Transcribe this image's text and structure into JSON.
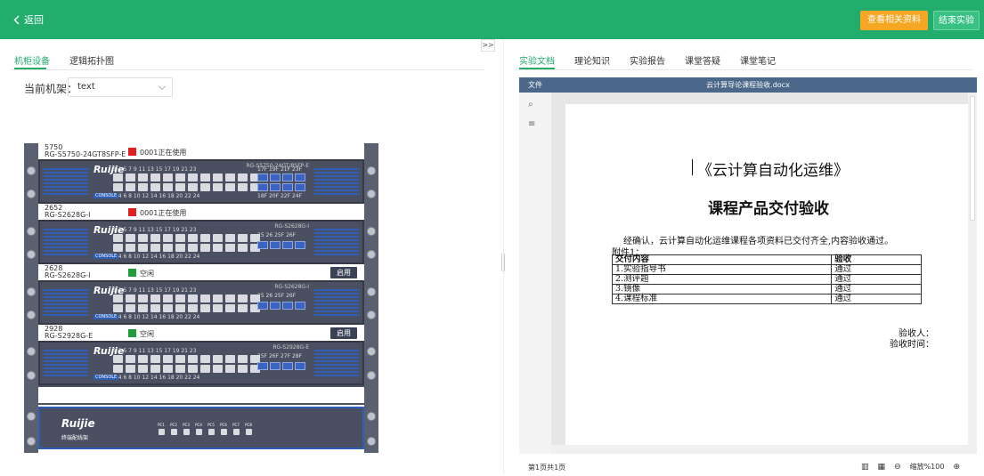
{
  "topbar": {
    "back_label": "返回",
    "materials_button": "查看相关资料",
    "end_button": "结束实验"
  },
  "left": {
    "tabs": [
      "机柜设备",
      "逻辑拓扑图"
    ],
    "rack_label": "当前机架：",
    "rack_select_value": "text",
    "collapse": ">>",
    "slots": [
      {
        "name": "5750",
        "model": "RG-S5750-24GT8SFP-E",
        "status": "0001正在使用",
        "status_color": "#e02020",
        "enable": ""
      },
      {
        "name": "2652",
        "model": "RG-S2628G-I",
        "status": "0001正在使用",
        "status_color": "#e02020",
        "enable": ""
      },
      {
        "name": "2628",
        "model": "RG-S2628G-I",
        "status": "空闲",
        "status_color": "#1f9d3b",
        "enable": "启用"
      },
      {
        "name": "2928",
        "model": "RG-S2928G-E",
        "status": "空闲",
        "status_color": "#1f9d3b",
        "enable": "启用"
      }
    ],
    "switches": [
      {
        "logo": "Ruijie",
        "model": "RG-S5750-24GT/8SFP-E",
        "top_nums": "1 3 5 7 9 11 13 15 17 19 21 23",
        "bot_nums": "2 4 6 8 10 12 14 16 18 20 22 24",
        "sfp_top": "17F 19F 21F 23F",
        "sfp_bot": "18F 20F 22F 24F",
        "console": "CONSOLE"
      },
      {
        "logo": "Ruijie",
        "model": "RG-S2628G-I",
        "top_nums": "1 3 5 7 9 11 13 15 17 19 21 23",
        "bot_nums": "2 4 6 8 10 12 14 16 18 20 22 24",
        "sfp_top": "25 26 25F 26F",
        "sfp_bot": "",
        "console": "CONSOLE"
      },
      {
        "logo": "Ruijie",
        "model": "RG-S2628G-I",
        "top_nums": "1 3 5 7 9 11 13 15 17 19 21 23",
        "bot_nums": "2 4 6 8 10 12 14 16 18 20 22 24",
        "sfp_top": "25 26 25F 26F",
        "sfp_bot": "",
        "console": "CONSOLE"
      },
      {
        "logo": "Ruijie",
        "model": "RG-S2928G-E",
        "top_nums": "1 3 5 7 9 11 13 15 17 19 21 23",
        "bot_nums": "2 4 6 8 10 12 14 16 18 20 22 24",
        "sfp_top": "25F 26F 27F 28F",
        "sfp_bot": "",
        "console": "CONSOLE"
      }
    ],
    "patch_panel": {
      "logo": "Ruijie",
      "sub": "终端配线架",
      "ports": [
        "PC1",
        "PC2",
        "PC3",
        "PC4",
        "PC5",
        "PC6",
        "PC7",
        "PC8"
      ]
    }
  },
  "right": {
    "tabs": [
      "实验文档",
      "理论知识",
      "实验报告",
      "课堂答疑",
      "课堂笔记"
    ],
    "doc_bar_left": "文件",
    "doc_filename": "云计算导论课程验收.docx",
    "doc": {
      "title1": "《云计算自动化运维》",
      "title2": "课程产品交付验收",
      "paragraph": "经确认，云计算自动化运维课程各项资料已交付齐全,内容验收通过。",
      "attachment": "附件1：",
      "table_headers": [
        "交付内容",
        "验收"
      ],
      "table_rows": [
        [
          "1.实验指导书",
          "通过"
        ],
        [
          "2.测评题",
          "通过"
        ],
        [
          "3.镜像",
          "通过"
        ],
        [
          "4.课程标准",
          "通过"
        ]
      ],
      "sig1": "验收人：",
      "sig2": "验收时间："
    },
    "status_page": "第1页共1页",
    "zoom_label": "缩放%100"
  }
}
